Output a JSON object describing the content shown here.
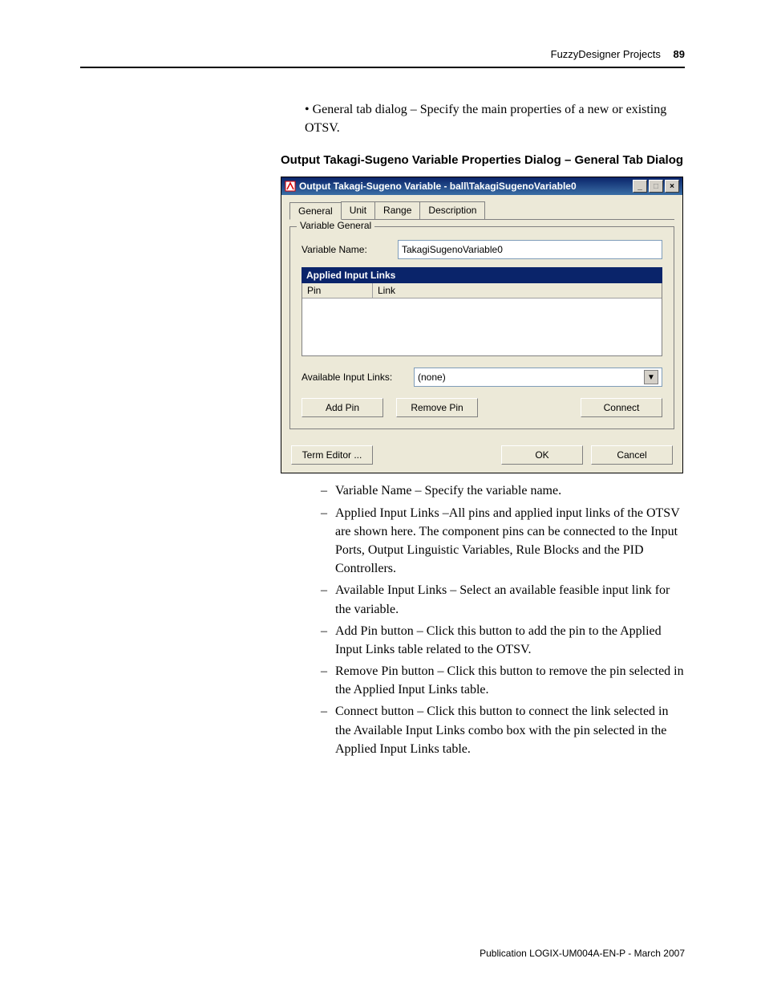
{
  "header": {
    "section_title": "FuzzyDesigner Projects",
    "page_number": "89"
  },
  "intro_bullet": "General tab dialog – Specify the main properties of a new or existing OTSV.",
  "section_heading": "Output Takagi-Sugeno Variable Properties Dialog – General Tab Dialog",
  "dialog": {
    "title": "Output Takagi-Sugeno Variable - ball\\TakagiSugenoVariable0",
    "tabs": [
      "General",
      "Unit",
      "Range",
      "Description"
    ],
    "fieldset_legend": "Variable General",
    "var_name_label": "Variable Name:",
    "var_name_value": "TakagiSugenoVariable0",
    "panel_title": "Applied Input Links",
    "col_pin": "Pin",
    "col_link": "Link",
    "avail_label": "Available Input Links:",
    "avail_value": "(none)",
    "btn_add": "Add Pin",
    "btn_remove": "Remove Pin",
    "btn_connect": "Connect",
    "btn_term_editor": "Term Editor ...",
    "btn_ok": "OK",
    "btn_cancel": "Cancel"
  },
  "descriptions": [
    "Variable Name – Specify the variable name.",
    "Applied Input Links –All pins and applied input links of the OTSV are shown here. The component pins can be connected to the Input Ports, Output Linguistic Variables, Rule Blocks and the PID Controllers.",
    "Available Input Links – Select an available feasible input link for the variable.",
    "Add Pin button – Click this button to add the pin to the Applied Input Links table related to the OTSV.",
    "Remove Pin button – Click this button to remove the pin selected in the Applied Input Links table.",
    "Connect button – Click this button to connect the link selected in the Available Input Links combo box with the pin selected in the Applied Input Links table."
  ],
  "footer": "Publication LOGIX-UM004A-EN-P - March 2007"
}
